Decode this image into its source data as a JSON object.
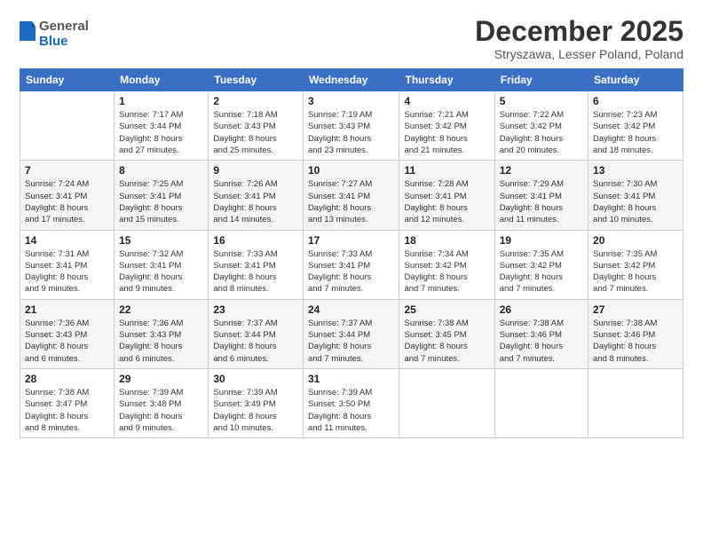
{
  "header": {
    "logo_general": "General",
    "logo_blue": "Blue",
    "month_title": "December 2025",
    "location": "Stryszawa, Lesser Poland, Poland"
  },
  "weekdays": [
    "Sunday",
    "Monday",
    "Tuesday",
    "Wednesday",
    "Thursday",
    "Friday",
    "Saturday"
  ],
  "weeks": [
    [
      {
        "num": "",
        "info": ""
      },
      {
        "num": "1",
        "info": "Sunrise: 7:17 AM\nSunset: 3:44 PM\nDaylight: 8 hours\nand 27 minutes."
      },
      {
        "num": "2",
        "info": "Sunrise: 7:18 AM\nSunset: 3:43 PM\nDaylight: 8 hours\nand 25 minutes."
      },
      {
        "num": "3",
        "info": "Sunrise: 7:19 AM\nSunset: 3:43 PM\nDaylight: 8 hours\nand 23 minutes."
      },
      {
        "num": "4",
        "info": "Sunrise: 7:21 AM\nSunset: 3:42 PM\nDaylight: 8 hours\nand 21 minutes."
      },
      {
        "num": "5",
        "info": "Sunrise: 7:22 AM\nSunset: 3:42 PM\nDaylight: 8 hours\nand 20 minutes."
      },
      {
        "num": "6",
        "info": "Sunrise: 7:23 AM\nSunset: 3:42 PM\nDaylight: 8 hours\nand 18 minutes."
      }
    ],
    [
      {
        "num": "7",
        "info": "Sunrise: 7:24 AM\nSunset: 3:41 PM\nDaylight: 8 hours\nand 17 minutes."
      },
      {
        "num": "8",
        "info": "Sunrise: 7:25 AM\nSunset: 3:41 PM\nDaylight: 8 hours\nand 15 minutes."
      },
      {
        "num": "9",
        "info": "Sunrise: 7:26 AM\nSunset: 3:41 PM\nDaylight: 8 hours\nand 14 minutes."
      },
      {
        "num": "10",
        "info": "Sunrise: 7:27 AM\nSunset: 3:41 PM\nDaylight: 8 hours\nand 13 minutes."
      },
      {
        "num": "11",
        "info": "Sunrise: 7:28 AM\nSunset: 3:41 PM\nDaylight: 8 hours\nand 12 minutes."
      },
      {
        "num": "12",
        "info": "Sunrise: 7:29 AM\nSunset: 3:41 PM\nDaylight: 8 hours\nand 11 minutes."
      },
      {
        "num": "13",
        "info": "Sunrise: 7:30 AM\nSunset: 3:41 PM\nDaylight: 8 hours\nand 10 minutes."
      }
    ],
    [
      {
        "num": "14",
        "info": "Sunrise: 7:31 AM\nSunset: 3:41 PM\nDaylight: 8 hours\nand 9 minutes."
      },
      {
        "num": "15",
        "info": "Sunrise: 7:32 AM\nSunset: 3:41 PM\nDaylight: 8 hours\nand 9 minutes."
      },
      {
        "num": "16",
        "info": "Sunrise: 7:33 AM\nSunset: 3:41 PM\nDaylight: 8 hours\nand 8 minutes."
      },
      {
        "num": "17",
        "info": "Sunrise: 7:33 AM\nSunset: 3:41 PM\nDaylight: 8 hours\nand 7 minutes."
      },
      {
        "num": "18",
        "info": "Sunrise: 7:34 AM\nSunset: 3:42 PM\nDaylight: 8 hours\nand 7 minutes."
      },
      {
        "num": "19",
        "info": "Sunrise: 7:35 AM\nSunset: 3:42 PM\nDaylight: 8 hours\nand 7 minutes."
      },
      {
        "num": "20",
        "info": "Sunrise: 7:35 AM\nSunset: 3:42 PM\nDaylight: 8 hours\nand 7 minutes."
      }
    ],
    [
      {
        "num": "21",
        "info": "Sunrise: 7:36 AM\nSunset: 3:43 PM\nDaylight: 8 hours\nand 6 minutes."
      },
      {
        "num": "22",
        "info": "Sunrise: 7:36 AM\nSunset: 3:43 PM\nDaylight: 8 hours\nand 6 minutes."
      },
      {
        "num": "23",
        "info": "Sunrise: 7:37 AM\nSunset: 3:44 PM\nDaylight: 8 hours\nand 6 minutes."
      },
      {
        "num": "24",
        "info": "Sunrise: 7:37 AM\nSunset: 3:44 PM\nDaylight: 8 hours\nand 7 minutes."
      },
      {
        "num": "25",
        "info": "Sunrise: 7:38 AM\nSunset: 3:45 PM\nDaylight: 8 hours\nand 7 minutes."
      },
      {
        "num": "26",
        "info": "Sunrise: 7:38 AM\nSunset: 3:46 PM\nDaylight: 8 hours\nand 7 minutes."
      },
      {
        "num": "27",
        "info": "Sunrise: 7:38 AM\nSunset: 3:46 PM\nDaylight: 8 hours\nand 8 minutes."
      }
    ],
    [
      {
        "num": "28",
        "info": "Sunrise: 7:38 AM\nSunset: 3:47 PM\nDaylight: 8 hours\nand 8 minutes."
      },
      {
        "num": "29",
        "info": "Sunrise: 7:39 AM\nSunset: 3:48 PM\nDaylight: 8 hours\nand 9 minutes."
      },
      {
        "num": "30",
        "info": "Sunrise: 7:39 AM\nSunset: 3:49 PM\nDaylight: 8 hours\nand 10 minutes."
      },
      {
        "num": "31",
        "info": "Sunrise: 7:39 AM\nSunset: 3:50 PM\nDaylight: 8 hours\nand 11 minutes."
      },
      {
        "num": "",
        "info": ""
      },
      {
        "num": "",
        "info": ""
      },
      {
        "num": "",
        "info": ""
      }
    ]
  ]
}
